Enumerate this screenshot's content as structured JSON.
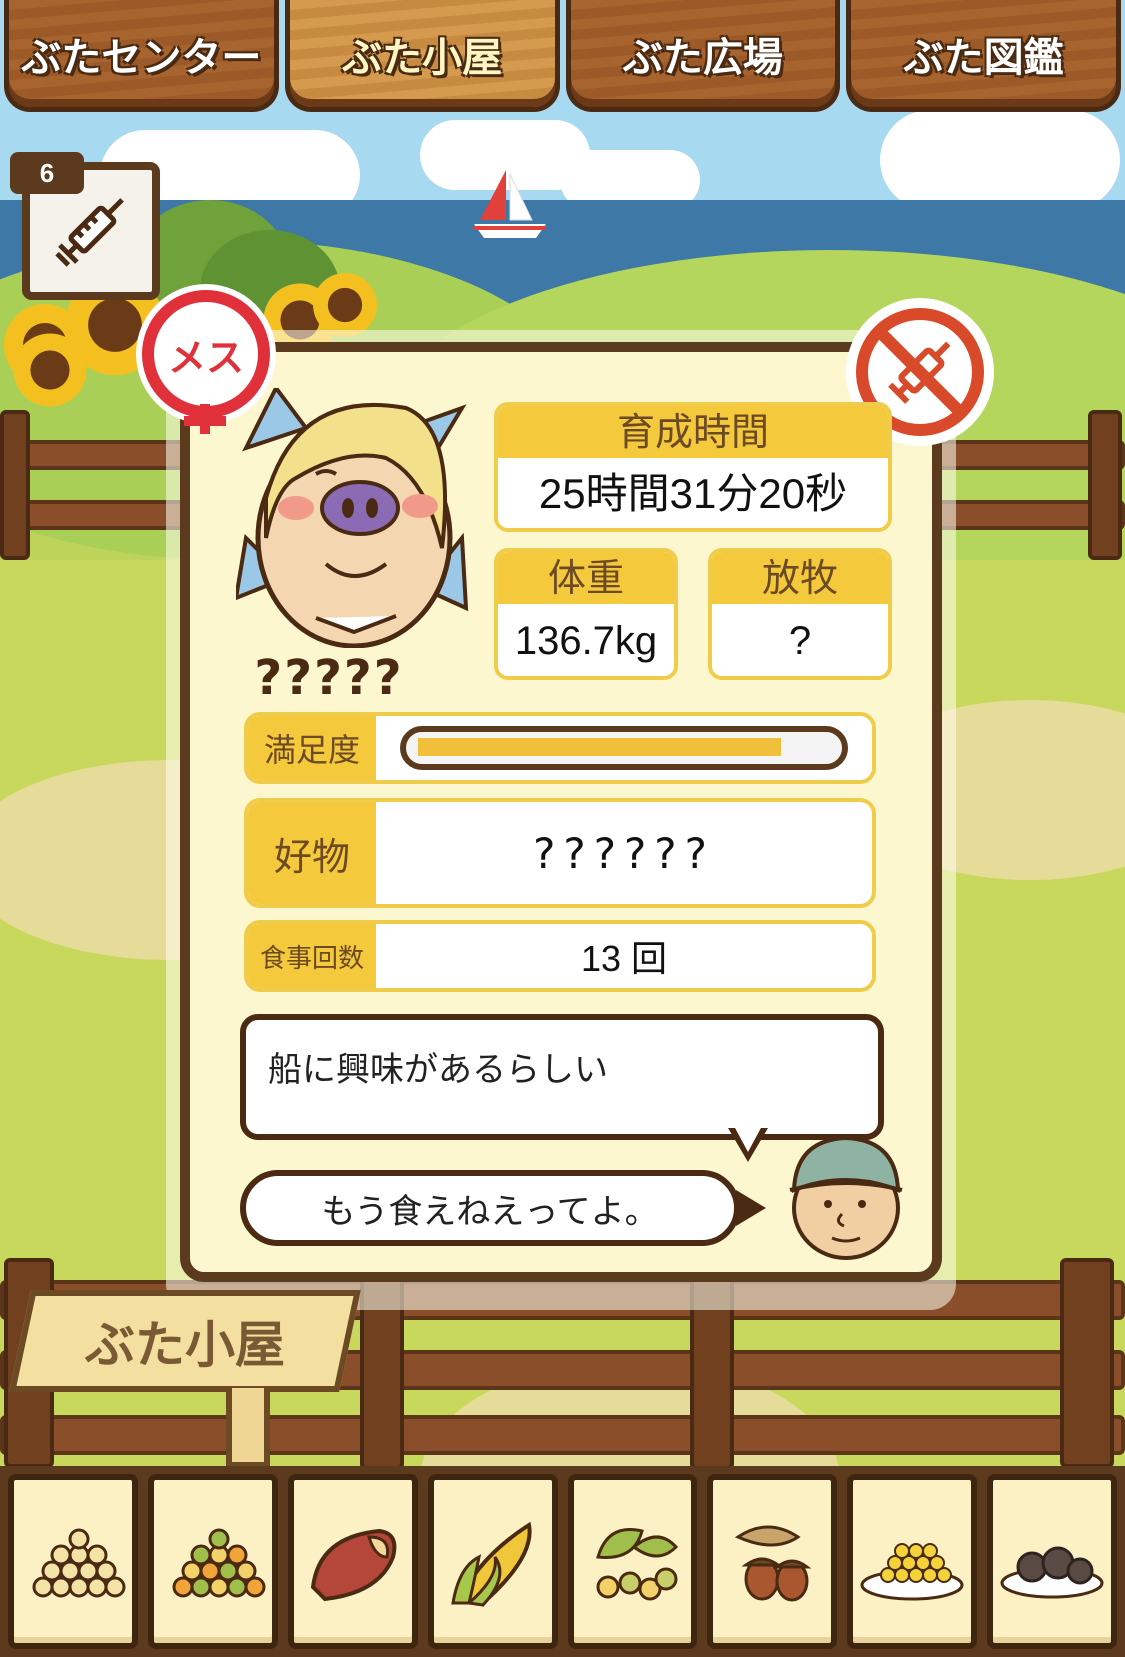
{
  "tabs": [
    {
      "label": "ぶたセンター"
    },
    {
      "label": "ぶた小屋"
    },
    {
      "label": "ぶた広場"
    },
    {
      "label": "ぶた図鑑"
    }
  ],
  "active_tab": "ぶた小屋",
  "injection": {
    "count": "6"
  },
  "pig": {
    "gender_badge": "メス",
    "name": "?????",
    "stats": {
      "raising_time_label": "育成時間",
      "raising_time_value": "25時間31分20秒",
      "weight_label": "体重",
      "weight_value": "136.7kg",
      "grazing_label": "放牧",
      "grazing_value": "?"
    },
    "satisfaction_label": "満足度",
    "satisfaction_level": 0.88,
    "favorite_label": "好物",
    "favorite_value": "??????",
    "meals_label": "食事回数",
    "meals_value": "13 回"
  },
  "message": "船に興味があるらしい",
  "reply_button": "もう食えねえってよ。",
  "sign": "ぶた小屋",
  "food_items": [
    {
      "icon": "soybeans-icon"
    },
    {
      "icon": "mixed-beans-icon"
    },
    {
      "icon": "sweet-potato-icon"
    },
    {
      "icon": "corn-icon"
    },
    {
      "icon": "herbs-icon"
    },
    {
      "icon": "acorn-icon"
    },
    {
      "icon": "corn-plate-icon"
    },
    {
      "icon": "truffle-plate-icon"
    }
  ],
  "colors": {
    "wood_dark": "#5b3a1e",
    "card_bg": "#fdf7d0",
    "label_yellow": "#f5c93c",
    "female_red": "#e0313b"
  }
}
